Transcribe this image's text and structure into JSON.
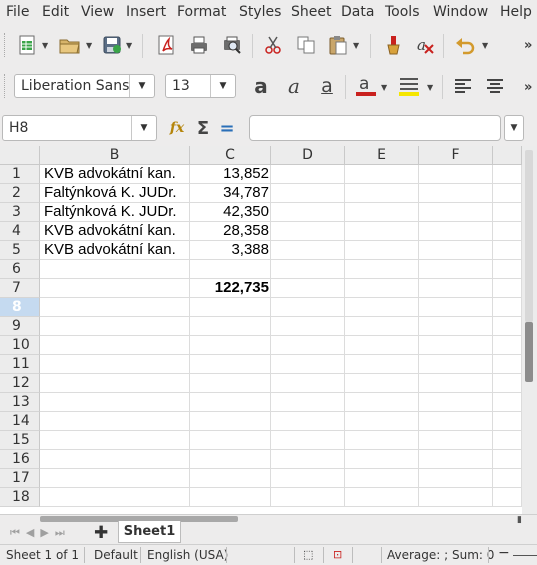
{
  "menu": [
    "File",
    "Edit",
    "View",
    "Insert",
    "Format",
    "Styles",
    "Sheet",
    "Data",
    "Tools",
    "Window",
    "Help"
  ],
  "font_name": "Liberation Sans",
  "font_size": "13",
  "name_box": "H8",
  "formula": "",
  "columns": [
    "B",
    "C",
    "D",
    "E",
    "F"
  ],
  "rows": [
    {
      "n": "1",
      "b": "KVB advokátní kan.",
      "c": "13,852"
    },
    {
      "n": "2",
      "b": "Faltýnková K. JUDr.",
      "c": "34,787"
    },
    {
      "n": "3",
      "b": "Faltýnková K. JUDr.",
      "c": "42,350"
    },
    {
      "n": "4",
      "b": "KVB advokátní kan.",
      "c": "28,358"
    },
    {
      "n": "5",
      "b": "KVB advokátní kan.",
      "c": "3,388"
    },
    {
      "n": "6",
      "b": "",
      "c": ""
    },
    {
      "n": "7",
      "b": "",
      "c": "122,735"
    },
    {
      "n": "8",
      "b": "",
      "c": ""
    },
    {
      "n": "9",
      "b": "",
      "c": ""
    },
    {
      "n": "10",
      "b": "",
      "c": ""
    },
    {
      "n": "11",
      "b": "",
      "c": ""
    },
    {
      "n": "12",
      "b": "",
      "c": ""
    },
    {
      "n": "13",
      "b": "",
      "c": ""
    },
    {
      "n": "14",
      "b": "",
      "c": ""
    },
    {
      "n": "15",
      "b": "",
      "c": ""
    },
    {
      "n": "16",
      "b": "",
      "c": ""
    },
    {
      "n": "17",
      "b": "",
      "c": ""
    },
    {
      "n": "18",
      "b": "",
      "c": ""
    }
  ],
  "selected_row": "8",
  "sheet_tab": "Sheet1",
  "status": {
    "sheet": "Sheet 1 of 1",
    "style": "Default",
    "language": "English (USA)",
    "summary": "Average: ; Sum: 0"
  },
  "colors": {
    "accent": "#c9211e",
    "highlight": "#f5e600",
    "selected_header": "#c5daf0"
  }
}
